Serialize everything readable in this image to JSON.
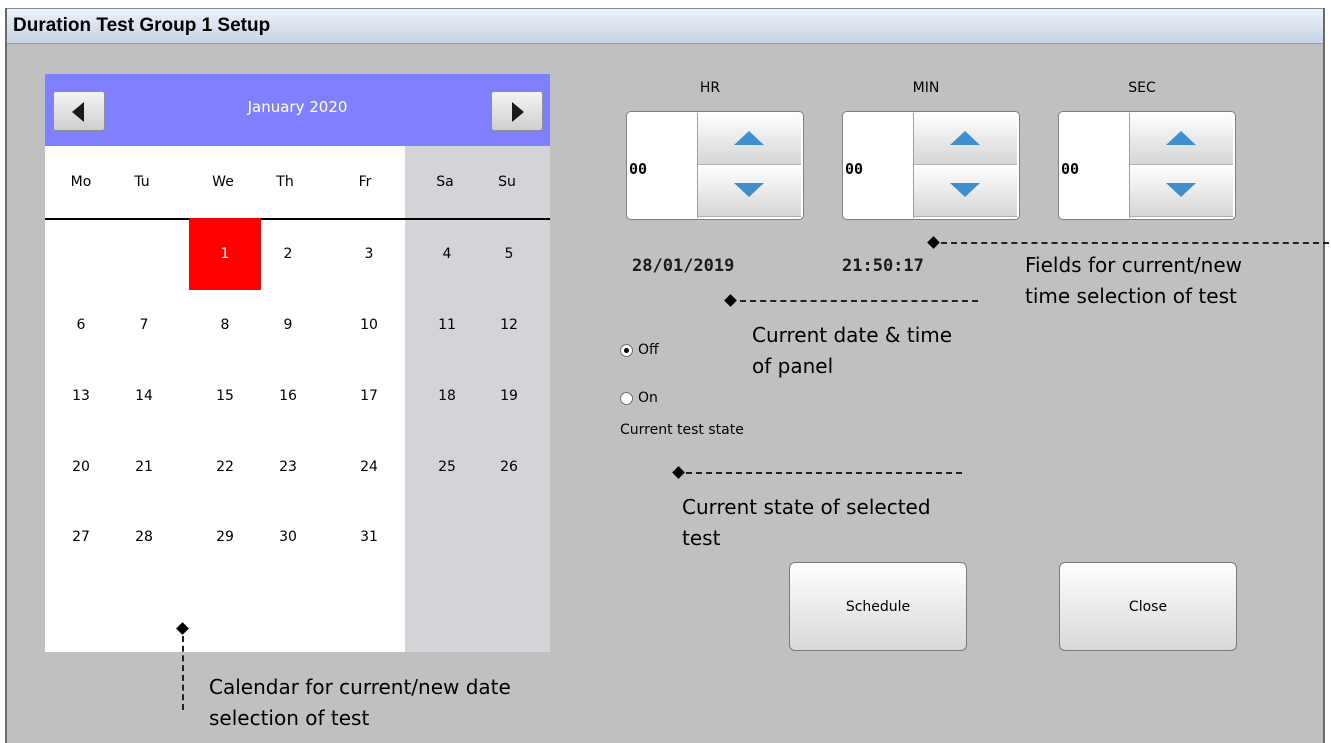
{
  "window": {
    "title": "Duration Test Group 1 Setup"
  },
  "calendar": {
    "month_label": "January 2020",
    "prev_icon": "triangle-left-icon",
    "next_icon": "triangle-right-icon",
    "weekdays": [
      "Mo",
      "Tu",
      "We",
      "Th",
      "Fr",
      "Sa",
      "Su"
    ],
    "days": [
      "1",
      "2",
      "3",
      "4",
      "5",
      "6",
      "7",
      "8",
      "9",
      "10",
      "11",
      "12",
      "13",
      "14",
      "15",
      "16",
      "17",
      "18",
      "19",
      "20",
      "21",
      "22",
      "23",
      "24",
      "25",
      "26",
      "27",
      "28",
      "29",
      "30",
      "31"
    ],
    "selected_day": "1",
    "selected_color": "#ff0000",
    "header_color": "#8080ff"
  },
  "time": {
    "hr": {
      "label": "HR",
      "value": "00"
    },
    "min": {
      "label": "MIN",
      "value": "00"
    },
    "sec": {
      "label": "SEC",
      "value": "00"
    },
    "up_icon": "arrow-up-icon",
    "down_icon": "arrow-down-icon"
  },
  "current": {
    "date": "28/01/2019",
    "time": "21:50:17"
  },
  "test_state": {
    "options": [
      {
        "label": "Off",
        "checked": true
      },
      {
        "label": "On",
        "checked": false
      }
    ],
    "caption": "Current test state"
  },
  "buttons": {
    "schedule": "Schedule",
    "close": "Close"
  },
  "annotations": {
    "time_fields": [
      "Fields for current/new",
      "time selection of test"
    ],
    "date_time": [
      "Current date & time",
      "of panel"
    ],
    "state": [
      "Current state of selected",
      "test"
    ],
    "calendar": [
      "Calendar for current/new date",
      "selection of test"
    ]
  }
}
